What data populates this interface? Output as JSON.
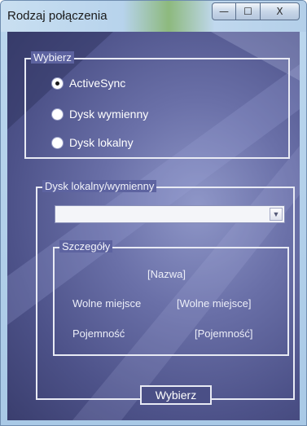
{
  "window": {
    "title": "Rodzaj połączenia",
    "controls": {
      "minimize": "—",
      "maximize": "☐",
      "close": "X"
    }
  },
  "choose_group": {
    "legend": "Wybierz",
    "options": [
      {
        "label": "ActiveSync",
        "selected": true
      },
      {
        "label": "Dysk wymienny",
        "selected": false
      },
      {
        "label": "Dysk lokalny",
        "selected": false
      }
    ]
  },
  "drive_group": {
    "legend": "Dysk lokalny/wymienny",
    "combo_value": "",
    "details": {
      "legend": "Szczegóły",
      "name_value": "[Nazwa]",
      "free_label": "Wolne miejsce",
      "free_value": "[Wolne miejsce]",
      "capacity_label": "Pojemność",
      "capacity_value": "[Pojemność]"
    }
  },
  "ok_button": "Wybierz"
}
